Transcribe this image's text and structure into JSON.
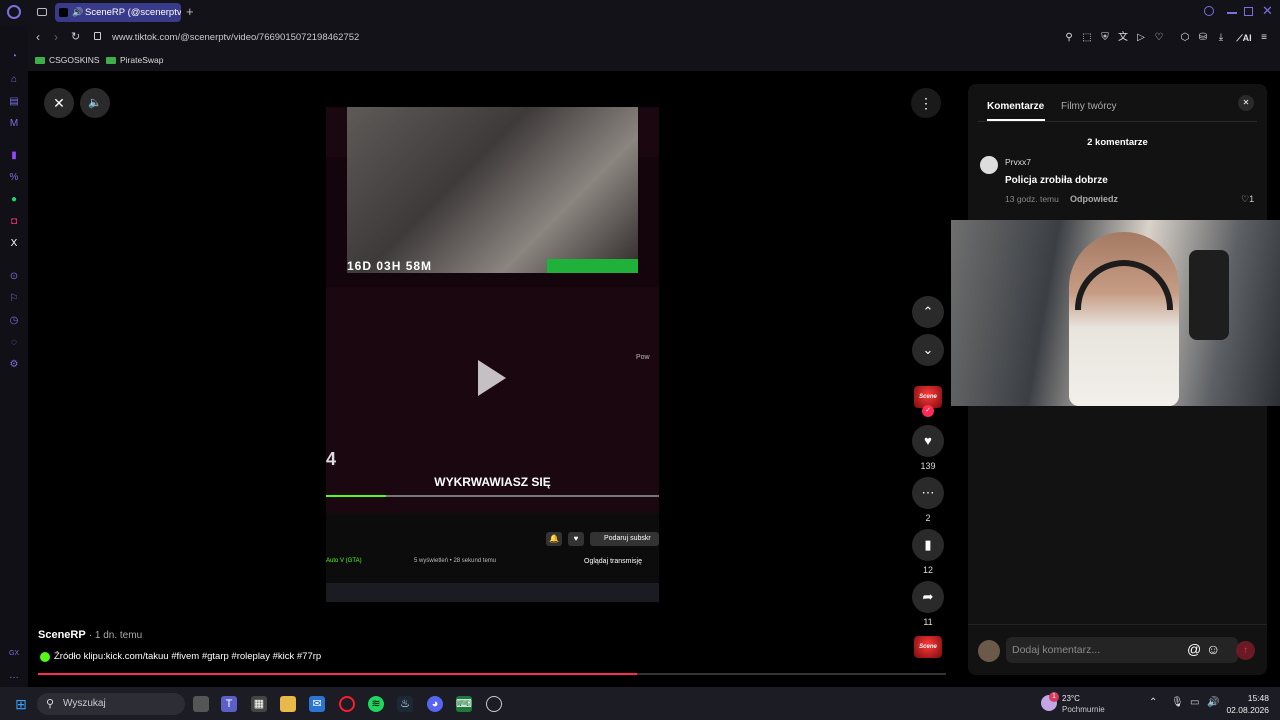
{
  "browser": {
    "tab_title": "SceneRP (@scenerptv)",
    "url": "www.tiktok.com/@scenerptv/video/7669015072198462752",
    "new_tab_symbol": "+",
    "bookmarks": [
      "CSGOSKINS",
      "PirateSwap"
    ],
    "ai_label": "AI"
  },
  "video": {
    "timer_text": "16D 03H 58M",
    "overlay_title": "WYKRWAWIASZ SIĘ",
    "subscribe_label": "Podaruj subskr",
    "watch_label": "Oglądaj transmisję",
    "stream_meta": "5 wyświetleń • 28 sekund temu",
    "game_label": "Auto V (GTA)",
    "side_number": "4",
    "side_tag": "Pow"
  },
  "post": {
    "author": "SceneRP",
    "time": "· 1 dn. temu",
    "caption": "Źródło klipu:kick.com/takuu #fivem #gtarp #roleplay #kick #77rp"
  },
  "actions": {
    "likes": "139",
    "comments": "2",
    "saves": "12",
    "shares": "11",
    "logo_text": "Scene"
  },
  "panel": {
    "tabs": [
      "Komentarze",
      "Filmy twórcy"
    ],
    "comment_count": "2 komentarze",
    "comments": [
      {
        "user": "Prvxx7",
        "text": "Policja zrobiła dobrze",
        "time": "13 godz. temu",
        "reply": "Odpowiedz",
        "likes": "1"
      }
    ],
    "input_placeholder": "Dodaj komentarz..."
  },
  "taskbar": {
    "search_label": "Wyszukaj",
    "weather_temp": "23°C",
    "weather_desc": "Pochmurnie",
    "weather_badge": "1",
    "time": "15:48",
    "date": "02.08.2026"
  },
  "colors": {
    "accent_red": "#fe2c55",
    "tab_active": "#3a3a8a",
    "opera_red": "#ff1b2d"
  }
}
